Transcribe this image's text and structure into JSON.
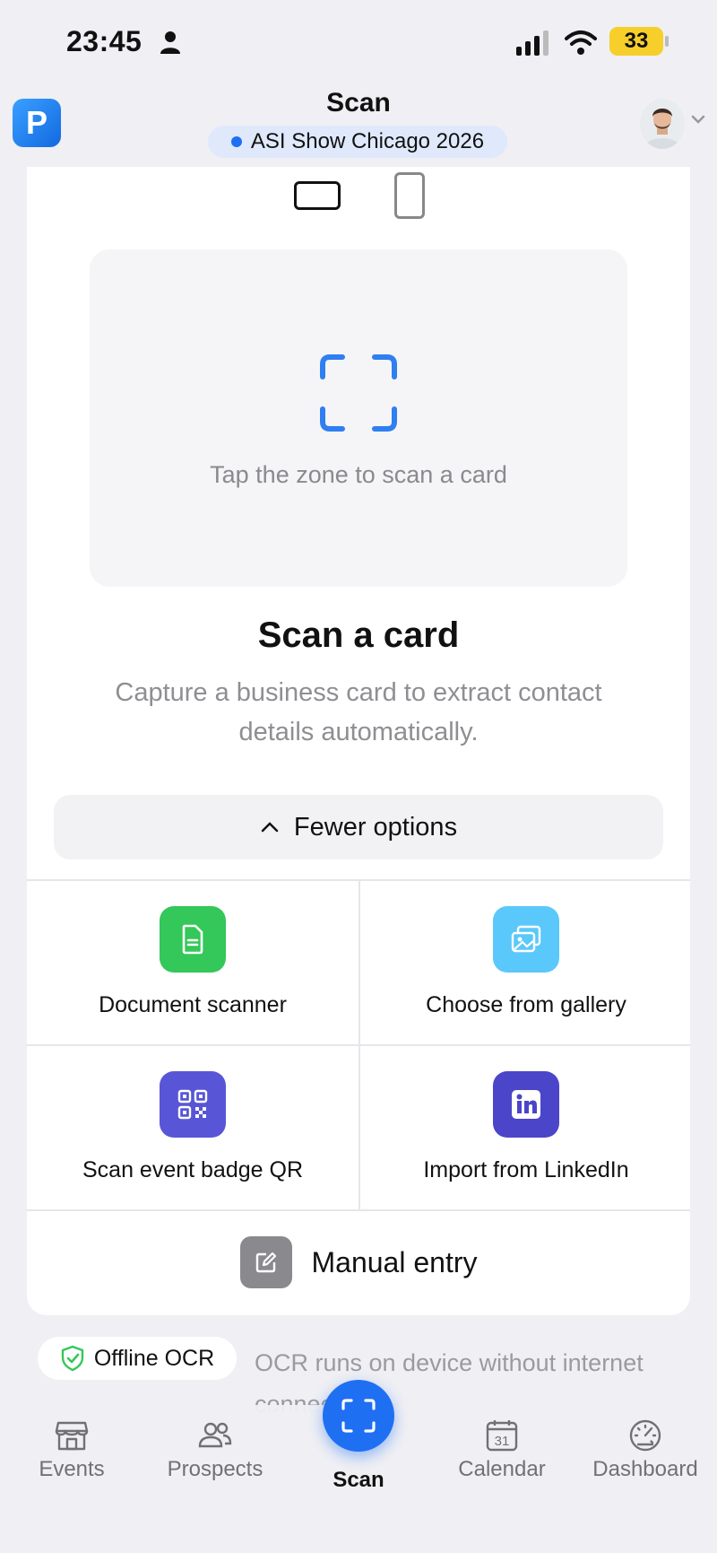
{
  "status": {
    "time": "23:45",
    "battery": "33"
  },
  "header": {
    "title": "Scan",
    "event": "ASI Show Chicago 2026",
    "logo_letter": "P"
  },
  "scan_zone": {
    "hint": "Tap the zone to scan a card"
  },
  "main": {
    "title": "Scan a card",
    "subtitle": "Capture a business card to extract contact details automatically.",
    "fewer_options": "Fewer options"
  },
  "options": [
    {
      "label": "Document scanner",
      "icon": "document-icon",
      "color": "#34c759"
    },
    {
      "label": "Choose from gallery",
      "icon": "gallery-icon",
      "color": "#5ac8fa"
    },
    {
      "label": "Scan event badge QR",
      "icon": "qr-code-icon",
      "color": "#5856d6"
    },
    {
      "label": "Import from LinkedIn",
      "icon": "linkedin-icon",
      "color": "#4b45c9"
    }
  ],
  "manual_entry": "Manual entry",
  "offline": {
    "badge": "Offline OCR",
    "note": "OCR runs on device without internet connection"
  },
  "tabs": {
    "events": "Events",
    "prospects": "Prospects",
    "scan": "Scan",
    "calendar": "Calendar",
    "calendar_day": "31",
    "dashboard": "Dashboard"
  },
  "colors": {
    "accent": "#1f6ff2",
    "background": "#efeff4"
  }
}
